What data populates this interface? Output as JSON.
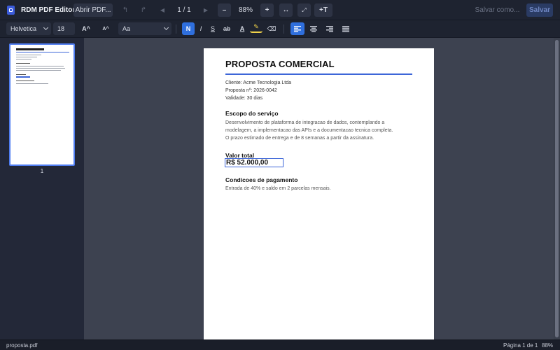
{
  "app": {
    "title": "RDM PDF Editor"
  },
  "toolbar": {
    "open_label": "Abrir PDF...",
    "undo_icon": "↰",
    "redo_icon": "↱",
    "prev_icon": "◀",
    "page_indicator": "1 / 1",
    "next_icon": "▶",
    "zoom_out_label": "–",
    "zoom_level": "88%",
    "zoom_in_label": "+",
    "fit_width_icon": "↔",
    "expand_icon": "⤢",
    "add_text_label": "+T",
    "save_as_label": "Salvar como...",
    "save_label": "Salvar"
  },
  "format": {
    "font_family": "Helvetica",
    "font_size": "18",
    "increase_size_label": "A^",
    "decrease_size_label": "A^",
    "style_preset": "Aa",
    "bold_label": "N",
    "italic_label": "I",
    "underline_label": "S",
    "strike_label": "ab",
    "text_color_label": "A",
    "highlight_label": "✎",
    "clear_format_label": "⌫"
  },
  "sidebar": {
    "thumbnail_page_number": "1"
  },
  "document": {
    "title": "PROPOSTA COMERCIAL",
    "client_line": "Cliente: Acme Tecnologia Ltda",
    "proposal_line": "Proposta nº: 2026-0042",
    "validity_line": "Validade: 30 dias",
    "scope_heading": "Escopo do serviço",
    "scope_line1": "Desenvolvimento de plataforma de integracao de dados, contemplando a",
    "scope_line2": "modelagem, a implementacao das APIs e a documentacao tecnica completa.",
    "scope_line3": "O prazo estimado de entrega e de 8 semanas a partir da assinatura.",
    "total_heading": "Valor total",
    "total_value": "R$ 52.000,00",
    "payment_heading": "Condicoes de pagamento",
    "payment_line": "Entrada de 40% e saldo em 2 parcelas mensais."
  },
  "statusbar": {
    "filename": "proposta.pdf",
    "page_info": "Página 1 de 1",
    "zoom": "88%"
  },
  "colors": {
    "accent": "#2f6fdd",
    "toolbar_bg": "#1e2330",
    "canvas_bg": "#3d4250",
    "doc_rule": "#3d66d8"
  }
}
